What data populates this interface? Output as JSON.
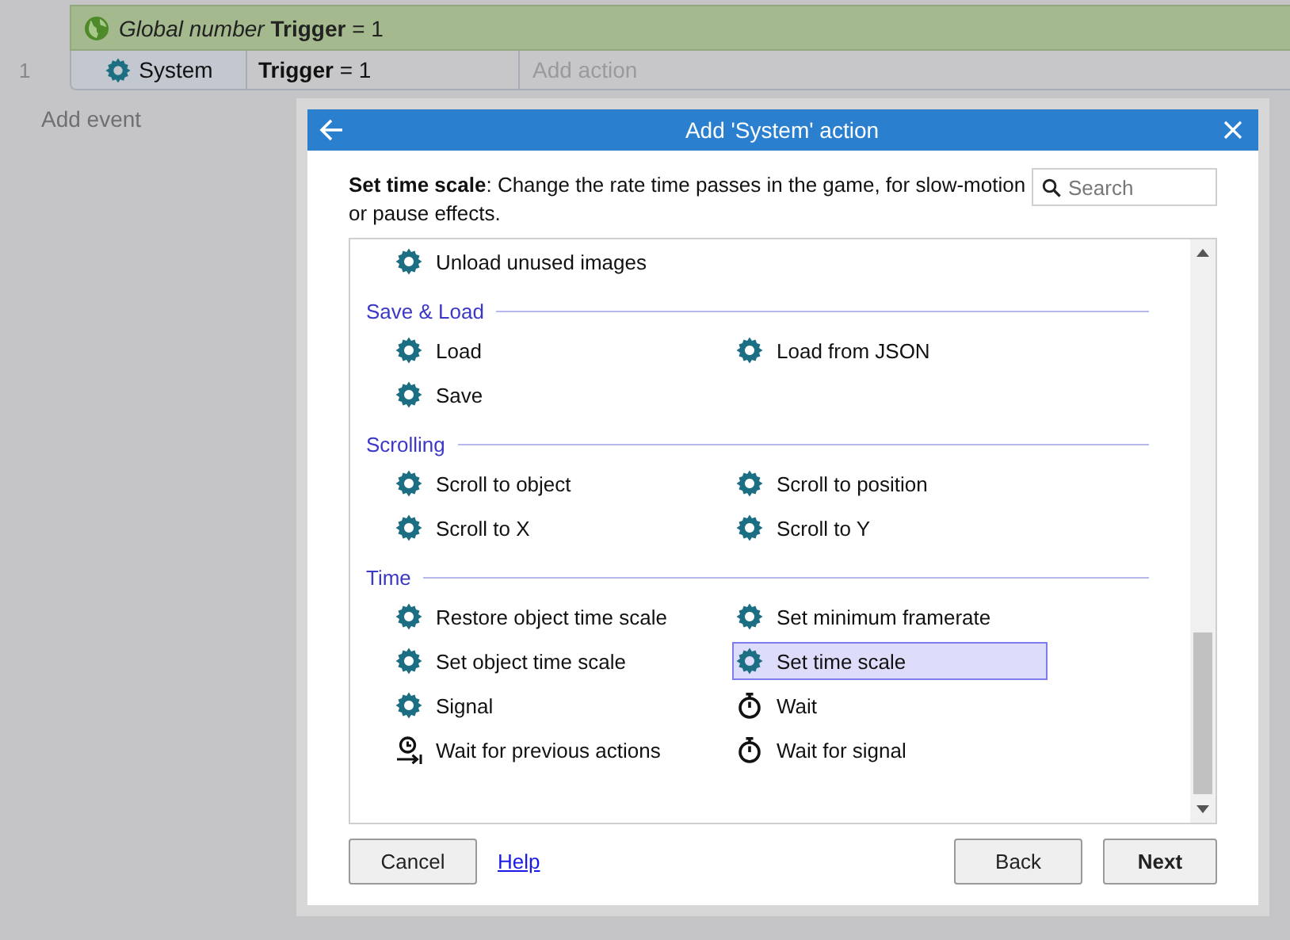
{
  "sheet": {
    "condition_row": {
      "prefix": "Global number",
      "name": "Trigger",
      "rest": "= 1"
    },
    "event": {
      "number": "1",
      "object": "System",
      "condition_name": "Trigger",
      "condition_rest": "= 1",
      "add_action": "Add action"
    },
    "add_event": "Add event"
  },
  "dialog": {
    "title": "Add 'System' action",
    "description": {
      "name": "Set time scale",
      "text": ": Change the rate time passes in the game, for slow-motion or pause effects."
    },
    "search": {
      "placeholder": "Search"
    },
    "sections": [
      {
        "items": [
          {
            "label": "Unload unused images",
            "kind": "gear",
            "selected": false
          }
        ]
      },
      {
        "heading": "Save & Load",
        "items": [
          {
            "label": "Load",
            "kind": "gear",
            "selected": false
          },
          {
            "label": "Load from JSON",
            "kind": "gear",
            "selected": false
          },
          {
            "label": "Save",
            "kind": "gear",
            "selected": false
          }
        ]
      },
      {
        "heading": "Scrolling",
        "items": [
          {
            "label": "Scroll to object",
            "kind": "gear",
            "selected": false
          },
          {
            "label": "Scroll to position",
            "kind": "gear",
            "selected": false
          },
          {
            "label": "Scroll to X",
            "kind": "gear",
            "selected": false
          },
          {
            "label": "Scroll to Y",
            "kind": "gear",
            "selected": false
          }
        ]
      },
      {
        "heading": "Time",
        "items": [
          {
            "label": "Restore object time scale",
            "kind": "gear",
            "selected": false
          },
          {
            "label": "Set minimum framerate",
            "kind": "gear",
            "selected": false
          },
          {
            "label": "Set object time scale",
            "kind": "gear",
            "selected": false
          },
          {
            "label": "Set time scale",
            "kind": "gear",
            "selected": true
          },
          {
            "label": "Signal",
            "kind": "gear",
            "selected": false
          },
          {
            "label": "Wait",
            "kind": "stopwatch",
            "selected": false
          },
          {
            "label": "Wait for previous actions",
            "kind": "wait-previous",
            "selected": false
          },
          {
            "label": "Wait for signal",
            "kind": "stopwatch",
            "selected": false
          }
        ]
      }
    ],
    "buttons": {
      "cancel": "Cancel",
      "help": "Help",
      "back": "Back",
      "next": "Next"
    }
  }
}
